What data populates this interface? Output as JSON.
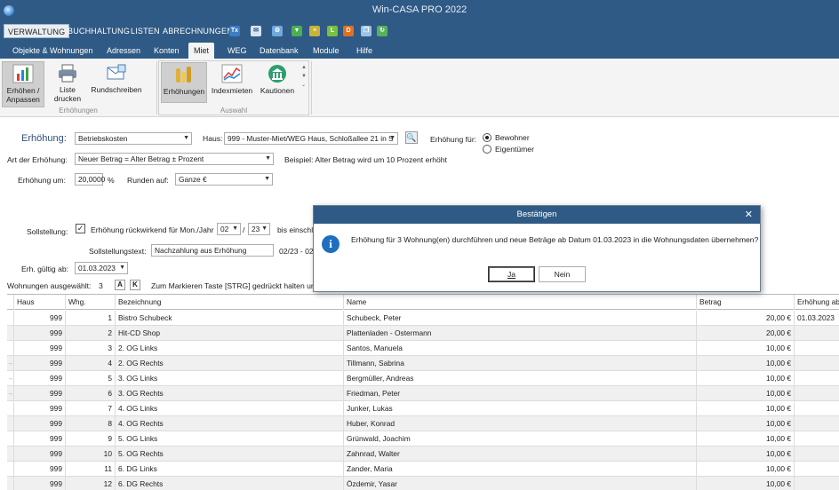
{
  "window": {
    "title": "Win-CASA PRO 2022"
  },
  "menu": {
    "items": [
      "VERWALTUNG",
      "BUCHHALTUNG",
      "LISTEN",
      "ABRECHNUNGEN"
    ],
    "quick_icons": [
      "tx-icon",
      "mail-icon",
      "gear-icon",
      "download-icon",
      "list-icon",
      "l-icon",
      "document-icon",
      "copy-icon",
      "refresh-icon"
    ]
  },
  "tabs": [
    "Objekte & Wohnungen",
    "Adressen",
    "Konten",
    "Miet",
    "WEG",
    "Datenbank",
    "Module",
    "Hilfe"
  ],
  "ribbon": {
    "group1": {
      "buttons": [
        {
          "line1": "Erhöhen /",
          "line2": "Anpassen"
        },
        {
          "line1": "Liste",
          "line2": "drucken"
        },
        {
          "line1": "Rundschreiben",
          "line2": ""
        }
      ],
      "label": "Erhöhungen"
    },
    "group2": {
      "buttons": [
        "Erhöhungen",
        "Indexmieten",
        "Kautionen"
      ],
      "label": "Auswahl"
    }
  },
  "form": {
    "erhoehung_label": "Erhöhung:",
    "erhoehung_value": "Betriebskosten",
    "haus_label": "Haus:",
    "haus_value": "999 - Muster-Miet/WEG Haus, Schloßallee 21 in S",
    "erhoehung_fuer_label": "Erhöhung für:",
    "radio_bewohner": "Bewohner",
    "radio_eigentuemer": "Eigentümer",
    "art_label": "Art der Erhöhung:",
    "art_value": "Neuer Betrag = Alter Betrag ± Prozent",
    "beispiel": "Beispiel: Alter Betrag wird um 10 Prozent erhöht",
    "erh_um_label": "Erhöhung um:",
    "erh_um_value": "20,0000",
    "percent": "%",
    "runden_label": "Runden auf:",
    "runden_value": "Ganze €",
    "sollstellung_label": "Sollstellung:",
    "rueckwirkend_label": "Erhöhung rückwirkend für Mon./Jahr",
    "monat": "02",
    "slash": "/",
    "jahr": "23",
    "bis_label": "bis einschl.",
    "solltext_label": "Sollstellungstext:",
    "solltext_value": "Nachzahlung aus Erhöhung",
    "solltext_suffix": "02/23 - 02",
    "gueltig_label": "Erh. gültig ab:",
    "gueltig_value": "01.03.2023",
    "ausgewaehlt_label": "Wohnungen ausgewählt:",
    "ausgewaehlt_count": "3",
    "btn_a": "A",
    "btn_k": "K",
    "hint": "Zum Markieren Taste [STRG] gedrückt halten und"
  },
  "grid": {
    "columns": [
      "Haus",
      "Whg.",
      "Bezeichnung",
      "Name",
      "Betrag",
      "Erhöhung ab"
    ],
    "rows": [
      {
        "haus": "999",
        "whg": "1",
        "bez": "Bistro Schubeck",
        "name": "Schubeck, Peter",
        "betrag": "20,00 €",
        "ab": "01.03.2023",
        "mark": ""
      },
      {
        "haus": "999",
        "whg": "2",
        "bez": "Hit-CD Shop",
        "name": "Plattenladen - Ostermann",
        "betrag": "20,00 €",
        "ab": "",
        "mark": ""
      },
      {
        "haus": "999",
        "whg": "3",
        "bez": "2. OG Links",
        "name": "Santos, Manuela",
        "betrag": "10,00 €",
        "ab": "",
        "mark": ""
      },
      {
        "haus": "999",
        "whg": "4",
        "bez": "2. OG Rechts",
        "name": "Tillmann, Sabrina",
        "betrag": "10,00 €",
        "ab": "",
        "mark": "→"
      },
      {
        "haus": "999",
        "whg": "5",
        "bez": "3. OG Links",
        "name": "Bergmüller, Andreas",
        "betrag": "10,00 €",
        "ab": "",
        "mark": "→"
      },
      {
        "haus": "999",
        "whg": "6",
        "bez": "3. OG Rechts",
        "name": "Friedman, Peter",
        "betrag": "10,00 €",
        "ab": "",
        "mark": "→"
      },
      {
        "haus": "999",
        "whg": "7",
        "bez": "4. OG Links",
        "name": "Junker, Lukas",
        "betrag": "10,00 €",
        "ab": "",
        "mark": ""
      },
      {
        "haus": "999",
        "whg": "8",
        "bez": "4. OG Rechts",
        "name": "Huber, Konrad",
        "betrag": "10,00 €",
        "ab": "",
        "mark": ""
      },
      {
        "haus": "999",
        "whg": "9",
        "bez": "5. OG Links",
        "name": "Grünwald, Joachim",
        "betrag": "10,00 €",
        "ab": "",
        "mark": ""
      },
      {
        "haus": "999",
        "whg": "10",
        "bez": "5. OG Rechts",
        "name": "Zahnrad, Walter",
        "betrag": "10,00 €",
        "ab": "",
        "mark": ""
      },
      {
        "haus": "999",
        "whg": "11",
        "bez": "6. DG Links",
        "name": "Zander, Maria",
        "betrag": "10,00 €",
        "ab": "",
        "mark": ""
      },
      {
        "haus": "999",
        "whg": "12",
        "bez": "6. DG Rechts",
        "name": "Özdemir, Yasar",
        "betrag": "10,00 €",
        "ab": "",
        "mark": ""
      }
    ]
  },
  "dialog": {
    "title": "Bestätigen",
    "close": "✕",
    "message": "Erhöhung für 3 Wohnung(en) durchführen und neue Beträge ab Datum 01.03.2023 in die Wohnungsdaten übernehmen?",
    "yes": "Ja",
    "no": "Nein"
  },
  "colors": {
    "titlebar": "#2f5a85",
    "accent": "#1f6fc0"
  }
}
